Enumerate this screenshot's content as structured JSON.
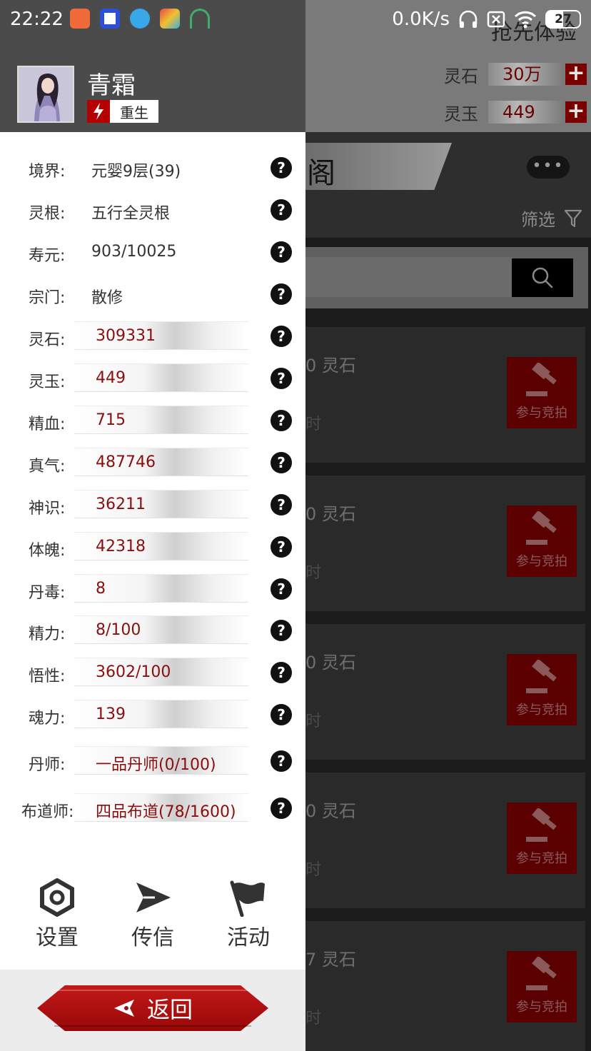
{
  "status_bar": {
    "time": "22:22",
    "net_speed": "0.0K/s",
    "battery": "27"
  },
  "background": {
    "title": "抢先体验",
    "currency": [
      {
        "label": "灵石",
        "value": "30万"
      },
      {
        "label": "灵玉",
        "value": "449"
      }
    ],
    "pavilion_title": "阁",
    "filter_label": "筛选",
    "cards": [
      {
        "price": "0 灵石",
        "bid_label": "参与竞拍"
      },
      {
        "price": "0 灵石",
        "bid_label": "参与竞拍"
      },
      {
        "price": "0 灵石",
        "bid_label": "参与竞拍"
      },
      {
        "price": "0 灵石",
        "bid_label": "参与竞拍"
      },
      {
        "price": "7 灵石",
        "bid_label": "参与竞拍"
      }
    ],
    "card_tail": "时"
  },
  "drawer": {
    "name": "青霜",
    "rebirth_label": "重生",
    "stats": [
      {
        "label": "境界:",
        "value": "元婴9层(39)"
      },
      {
        "label": "灵根:",
        "value": "五行全灵根"
      },
      {
        "label": "寿元:",
        "value": "903/10025"
      },
      {
        "label": "宗门:",
        "value": "散修"
      },
      {
        "label": "灵石:",
        "value": "309331"
      },
      {
        "label": "灵玉:",
        "value": "449"
      },
      {
        "label": "精血:",
        "value": "715"
      },
      {
        "label": "真气:",
        "value": "487746"
      },
      {
        "label": "神识:",
        "value": "36211"
      },
      {
        "label": "体魄:",
        "value": "42318"
      },
      {
        "label": "丹毒:",
        "value": "8"
      },
      {
        "label": "精力:",
        "value": "8/100"
      },
      {
        "label": "悟性:",
        "value": "3602/100"
      },
      {
        "label": "魂力:",
        "value": "139"
      },
      {
        "label": "丹师:",
        "value": "一品丹师(0/100)"
      },
      {
        "label": "布道师:",
        "value": "四品布道(78/1600)"
      }
    ],
    "help_glyph": "?",
    "menu": [
      {
        "label": "设置",
        "icon": "gear-icon"
      },
      {
        "label": "传信",
        "icon": "send-icon"
      },
      {
        "label": "活动",
        "icon": "flag-icon"
      }
    ],
    "back_label": "返回"
  }
}
